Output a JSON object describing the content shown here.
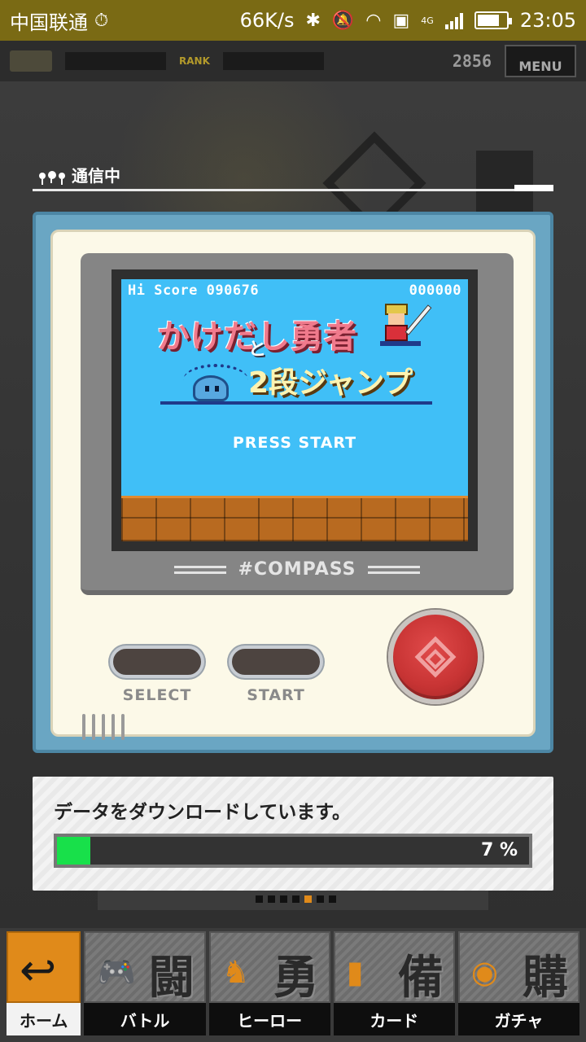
{
  "status_bar": {
    "carrier": "中国联通",
    "speed": "66K/s",
    "network": "4G",
    "time": "23:05"
  },
  "game_header": {
    "rank_label": "RANK",
    "points": "2856",
    "menu_label": "MENU"
  },
  "connection": {
    "label": "通信中"
  },
  "handheld": {
    "hi_score_label": "Hi Score",
    "hi_score": "090676",
    "score": "000000",
    "title_line1": "かけだし勇者",
    "title_to": "と",
    "title_line2": "2段ジャンプ",
    "press_start": "PRESS START",
    "brand": "#COMPASS",
    "select_label": "SELECT",
    "start_label": "START"
  },
  "download": {
    "message": "データをダウンロードしています。",
    "progress_percent": 7,
    "progress_text": "7 %"
  },
  "pager": {
    "count": 7,
    "active_index": 4
  },
  "bottom_nav": {
    "items": [
      {
        "label": "ホーム",
        "kanji": "",
        "icon": "back-arrow-icon"
      },
      {
        "label": "バトル",
        "kanji": "闘",
        "icon": "gamepad-icon"
      },
      {
        "label": "ヒーロー",
        "kanji": "勇",
        "icon": "hero-icon"
      },
      {
        "label": "カード",
        "kanji": "備",
        "icon": "cards-icon"
      },
      {
        "label": "ガチャ",
        "kanji": "購",
        "icon": "gacha-icon"
      }
    ]
  },
  "colors": {
    "status_bar": "#7a6a14",
    "device_frame": "#6aa6c3",
    "lcd_sky": "#40bff7",
    "progress_fill": "#18e04a",
    "accent_orange": "#e08a1a",
    "a_button": "#c83434"
  }
}
